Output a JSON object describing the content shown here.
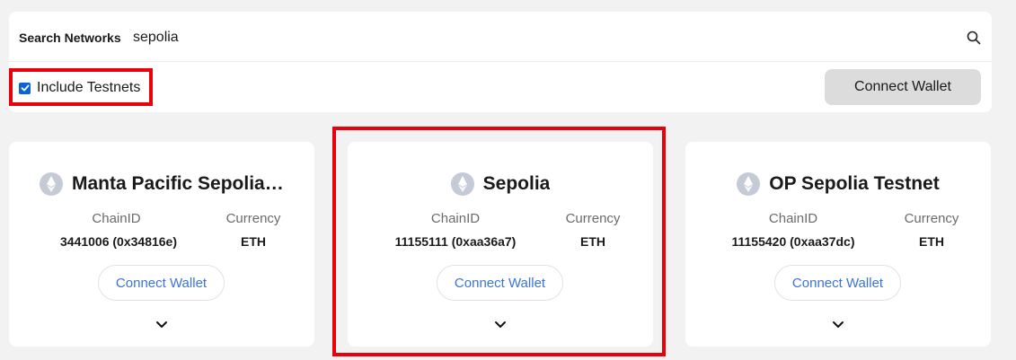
{
  "search": {
    "label": "Search Networks",
    "value": "sepolia",
    "icon": "search-icon"
  },
  "filters": {
    "include_testnets_label": "Include Testnets",
    "include_testnets_checked": true
  },
  "header": {
    "connect_wallet_label": "Connect Wallet"
  },
  "colors": {
    "highlight": "#e8000b",
    "link": "#3b74d6",
    "checkbox": "#0b63d6"
  },
  "networks": [
    {
      "name": "Manta Pacific Sepolia Te...",
      "icon": "ethereum-icon",
      "chain_id_label": "ChainID",
      "chain_id": "3441006 (0x34816e)",
      "currency_label": "Currency",
      "currency": "ETH",
      "connect_label": "Connect Wallet"
    },
    {
      "name": "Sepolia",
      "icon": "ethereum-icon",
      "chain_id_label": "ChainID",
      "chain_id": "11155111 (0xaa36a7)",
      "currency_label": "Currency",
      "currency": "ETH",
      "connect_label": "Connect Wallet"
    },
    {
      "name": "OP Sepolia Testnet",
      "icon": "ethereum-icon",
      "chain_id_label": "ChainID",
      "chain_id": "11155420 (0xaa37dc)",
      "currency_label": "Currency",
      "currency": "ETH",
      "connect_label": "Connect Wallet"
    }
  ]
}
